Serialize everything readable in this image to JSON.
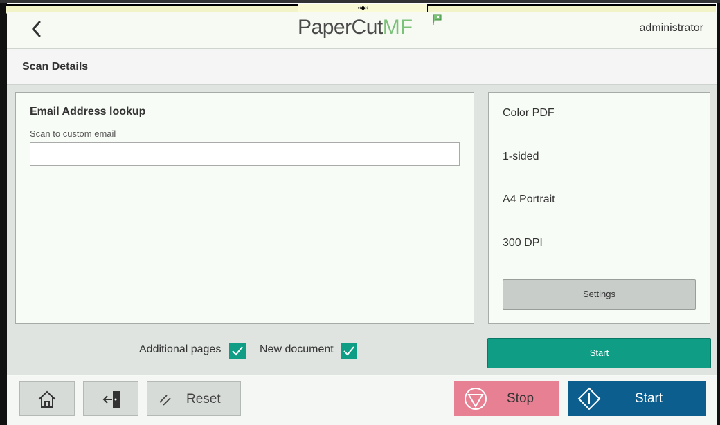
{
  "header": {
    "logo_paper": "PaperCut",
    "logo_mf": "MF",
    "user": "administrator"
  },
  "subheader": {
    "title": "Scan Details"
  },
  "lookup": {
    "title": "Email Address lookup",
    "field_label": "Scan to custom email",
    "field_value": "",
    "field_placeholder": ""
  },
  "scan_settings": {
    "color": "Color PDF",
    "sides": "1-sided",
    "paper": "A4 Portrait",
    "resolution": "300 DPI",
    "settings_label": "Settings"
  },
  "options": {
    "additional_pages_label": "Additional pages",
    "additional_pages_checked": true,
    "new_document_label": "New document",
    "new_document_checked": true
  },
  "actions": {
    "start_small_label": "Start",
    "reset_label": "Reset",
    "stop_label": "Stop",
    "start_label": "Start"
  },
  "icons": {
    "back": "chevron-left-icon",
    "home": "home-icon",
    "logout": "logout-icon",
    "reset": "reset-slash-icon",
    "stop": "stop-icon",
    "start": "start-diamond-icon",
    "check": "check-icon"
  },
  "colors": {
    "accent_green": "#0f9d85",
    "stop_pink": "#e88094",
    "start_blue": "#0b5e8e",
    "logo_green": "#7cc17a"
  }
}
